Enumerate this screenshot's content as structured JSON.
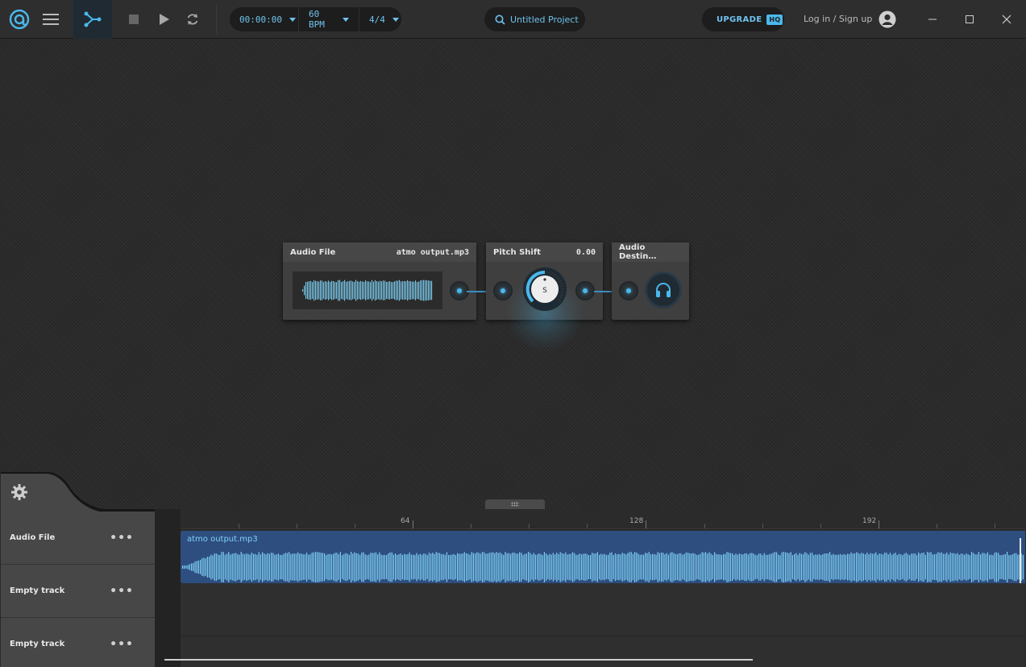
{
  "toolbar": {
    "time": "00:00:00",
    "bpm": "60 BPM",
    "time_signature": "4/4",
    "project_title": "Untitled Project",
    "upgrade_label": "UPGRADE",
    "upgrade_badge": "HQ",
    "login_label": "Log in / Sign up",
    "icons": [
      "app-logo-icon",
      "hamburger-menu-icon",
      "node-graph-icon",
      "stop-icon",
      "play-icon",
      "loop-icon",
      "search-icon",
      "user-avatar-icon",
      "minimize-icon",
      "maximize-icon",
      "close-icon"
    ]
  },
  "nodes": {
    "audio_file": {
      "title": "Audio File",
      "value": "atmo output.mp3"
    },
    "pitch_shift": {
      "title": "Pitch Shift",
      "value": "0.00",
      "knob_label": "S"
    },
    "audio_destination": {
      "title": "Audio Destin…"
    }
  },
  "timeline": {
    "ruler_labels": [
      "64",
      "128",
      "192"
    ],
    "clip_name": "atmo output.mp3",
    "tracks": [
      {
        "name": "Audio File",
        "menu": "•••"
      },
      {
        "name": "Empty track",
        "menu": "•••"
      },
      {
        "name": "Empty track",
        "menu": "•••"
      }
    ]
  },
  "colors": {
    "accent": "#4ab8ec",
    "accent_text": "#6fc3ee",
    "clip_bg": "#2f4e80",
    "toolbar_bg": "#2e2e2e"
  }
}
